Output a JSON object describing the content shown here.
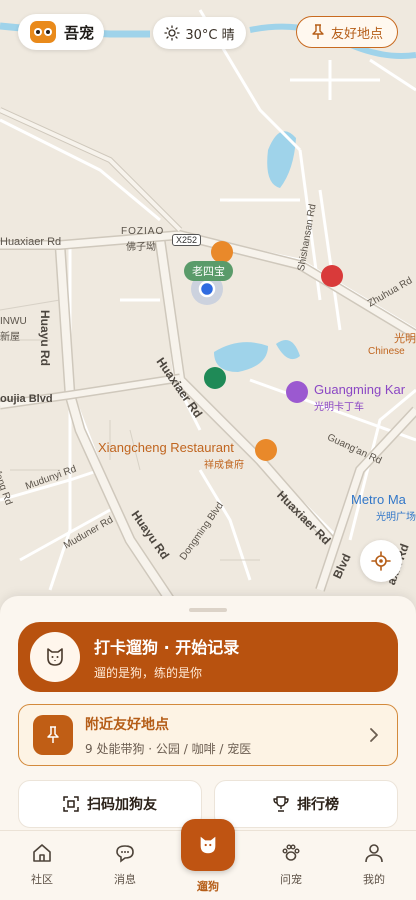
{
  "header": {
    "app_name": "吾宠",
    "weather_text": "30°C 晴",
    "friendly_places_label": "友好地点"
  },
  "map": {
    "labels": {
      "foziao_en": "FOZIAO",
      "foziao_cn": "佛子坳",
      "x252": "X252",
      "huaxiaer_rd_top": "Huaxiaer Rd",
      "huayu_rd": "Huayu Rd",
      "jinwu": "INWU",
      "xinwu_cn": "新屋",
      "oujia_blvd": "oujia Blvd",
      "shishansan_rd": "Shishansan Rd",
      "zhuhua_rd": "Zhuhua Rd",
      "guangming_cn_right": "光明",
      "chinese_right": "Chinese",
      "huaxiaer_rd_mid": "Huaxiaer Rd",
      "guangming_kart_en": "Guangming Kar",
      "guangming_kart_cn": "光明卡丁车",
      "xiangcheng_en": "Xiangcheng Restaurant",
      "xiangcheng_cn": "祥成食府",
      "mudunyi_rd": "Mudunyi Rd",
      "guangan_rd": "Guang'an Rd",
      "dongming_blvd": "Dongming Blvd",
      "metro_en": "Metro Ma",
      "metro_cn": "光明广场",
      "muduner_rd": "Muduner Rd",
      "huaxiaer_rd_low": "Huaxiaer Rd",
      "huayu_rd_low": "Huayu Rd",
      "feng_rd": "feng Rd",
      "blvd_low": "Blvd",
      "axia_rd": "axia Rd",
      "laosibao": "老四宝",
      "gua_rd": "Gua",
      "hua_rd": "Hua"
    },
    "colors": {
      "land": "#efe9df",
      "road": "#ffffff",
      "road_edge": "#d7d1c6",
      "water": "#9fd3ea",
      "major_road": "#f6f2ea",
      "location_dot": "#2f6be0"
    }
  },
  "location_button": {
    "icon": "crosshair-icon"
  },
  "sheet": {
    "walk_title": "打卡遛狗 · 开始记录",
    "walk_subtitle": "遛的是狗，练的是你",
    "nearby_title": "附近友好地点",
    "nearby_subtitle": "9 处能带狗 · 公园 / 咖啡 / 宠医",
    "scan_label": "扫码加狗友",
    "rank_label": "排行榜"
  },
  "tabs": [
    {
      "label": "社区",
      "icon": "home-icon"
    },
    {
      "label": "消息",
      "icon": "message-icon"
    },
    {
      "label": "遛狗",
      "icon": "dog-icon"
    },
    {
      "label": "问宠",
      "icon": "paw-icon"
    },
    {
      "label": "我的",
      "icon": "person-icon"
    }
  ],
  "colors": {
    "accent": "#b8520f",
    "accent_light": "#fdf3e4"
  }
}
